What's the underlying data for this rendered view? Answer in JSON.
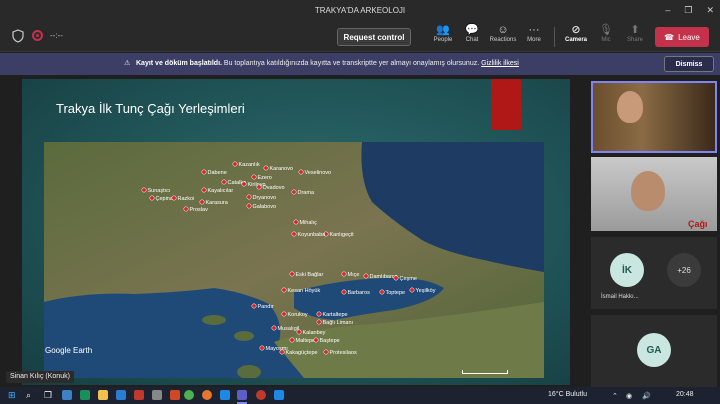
{
  "window": {
    "title": "TRAKYA'DA ARKEOLOJI",
    "controls": [
      "–",
      "❐",
      "✕"
    ]
  },
  "toolbar": {
    "timer": "--:--",
    "request_control": "Request control",
    "items": [
      {
        "label": "People",
        "icon": "people-icon"
      },
      {
        "label": "Chat",
        "icon": "chat-icon"
      },
      {
        "label": "Reactions",
        "icon": "reactions-icon"
      },
      {
        "label": "More",
        "icon": "more-icon"
      },
      {
        "label": "Camera",
        "icon": "camera-off-icon"
      },
      {
        "label": "Mic",
        "icon": "mic-off-icon"
      },
      {
        "label": "Share",
        "icon": "share-icon"
      }
    ],
    "leave": "Leave"
  },
  "banner": {
    "bold_text": "Kayıt ve döküm başlatıldı.",
    "text": "Bu toplantıya katıldığınızda kayıtta ve transkriptte yer almayı onaylamış olursunuz.",
    "link": "Gizlilik ilkesi",
    "dismiss": "Dismiss"
  },
  "slide": {
    "title": "Trakya İlk Tunç Çağı Yerleşimleri",
    "map_credit": "Google Earth",
    "sites": [
      {
        "name": "Kazanlık"
      },
      {
        "name": "Dabene"
      },
      {
        "name": "Karanovo"
      },
      {
        "name": "Veselinovo"
      },
      {
        "name": "Ezero"
      },
      {
        "name": "Catalka"
      },
      {
        "name": "Kirilovo"
      },
      {
        "name": "Ovadovo"
      },
      {
        "name": "Sunaştıcı"
      },
      {
        "name": "Kayalıcılar"
      },
      {
        "name": "Drama"
      },
      {
        "name": "Çepina"
      },
      {
        "name": "Razkoi"
      },
      {
        "name": "Dryanovo"
      },
      {
        "name": "Karasura"
      },
      {
        "name": "Proslav"
      },
      {
        "name": "Galabovo"
      },
      {
        "name": "Mihalıç"
      },
      {
        "name": "Kanlıgeçit"
      },
      {
        "name": "Koyunbaba"
      },
      {
        "name": "Eski Bağlar"
      },
      {
        "name": "Mıçe"
      },
      {
        "name": "Damlıbarca"
      },
      {
        "name": "Çeşme"
      },
      {
        "name": "Kesan Höyük"
      },
      {
        "name": "Barbaros"
      },
      {
        "name": "Toptepe"
      },
      {
        "name": "Yeşilköy"
      },
      {
        "name": "Pandır"
      },
      {
        "name": "Korukoy"
      },
      {
        "name": "Kartaltepe"
      },
      {
        "name": "Bağlı Limanı"
      },
      {
        "name": "Musalıgil"
      },
      {
        "name": "Kalanbey"
      },
      {
        "name": "Maltepe"
      },
      {
        "name": "Baştepe"
      },
      {
        "name": "Mayoşmı"
      },
      {
        "name": "Kakagüçtepe"
      },
      {
        "name": "Protesilaos"
      }
    ]
  },
  "participants": {
    "ik_initials": "İK",
    "more_count": "+26",
    "ik_name": "İsmail Hakkı...",
    "ga_initials": "GA",
    "slide_text": "Çağı"
  },
  "presenter": "Sinan Kılıç (Konuk)",
  "taskbar": {
    "weather": "16°C  Bulutlu",
    "time": "20:48"
  },
  "colors": {
    "accent": "#7f85f5",
    "leave": "#c4314b",
    "banner": "#3d3e66",
    "slide_red": "#b01818"
  }
}
